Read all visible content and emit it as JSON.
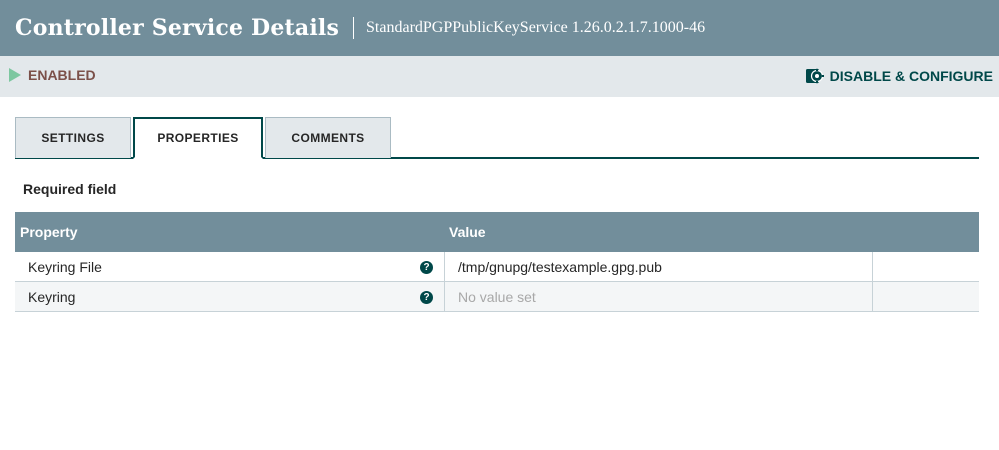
{
  "header": {
    "title": "Controller Service Details",
    "subtitle": "StandardPGPPublicKeyService 1.26.0.2.1.7.1000-46"
  },
  "status": {
    "state": "ENABLED",
    "state_icon": "play-icon",
    "action_label": "DISABLE & CONFIGURE",
    "action_icon": "gear-icon"
  },
  "tabs": [
    {
      "label": "SETTINGS",
      "active": false
    },
    {
      "label": "PROPERTIES",
      "active": true
    },
    {
      "label": "COMMENTS",
      "active": false
    }
  ],
  "required_label": "Required field",
  "table": {
    "headers": {
      "property": "Property",
      "value": "Value"
    },
    "rows": [
      {
        "property": "Keyring File",
        "help": "?",
        "value": "/tmp/gnupg/testexample.gpg.pub"
      },
      {
        "property": "Keyring",
        "help": "?",
        "value": "No value set"
      }
    ]
  },
  "colors": {
    "header_bg": "#728e9b",
    "status_bg": "#e3e8eb",
    "enabled_text": "#7b5049",
    "enabled_icon": "#7dc7a0",
    "accent": "#004849"
  }
}
